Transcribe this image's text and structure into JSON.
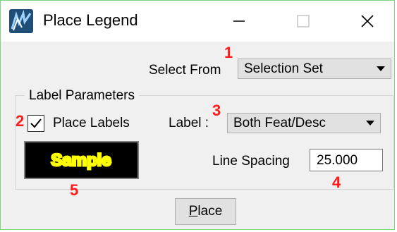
{
  "window": {
    "title": "Place Legend",
    "icon": "app-logo-icon",
    "controls": [
      "minimize-icon",
      "maximize-icon",
      "close-icon"
    ]
  },
  "select_from": {
    "label": "Select From",
    "value": "Selection Set"
  },
  "label_parameters": {
    "title": "Label Parameters",
    "place_labels": {
      "label": "Place Labels",
      "checked": true
    },
    "label_combo": {
      "label": "Label :",
      "value": "Both Feat/Desc"
    },
    "line_spacing": {
      "label": "Line Spacing",
      "value": "25.000"
    },
    "sample": {
      "text": "Sample",
      "bg_color": "#000000",
      "text_color": "#ffff00"
    }
  },
  "place_button": {
    "label": "Place",
    "mnemonic": "P"
  },
  "annotations": [
    "1",
    "2",
    "3",
    "4",
    "5"
  ],
  "colors": {
    "annotation": "#ff1a1a",
    "accent_border": "#7fd57f"
  }
}
